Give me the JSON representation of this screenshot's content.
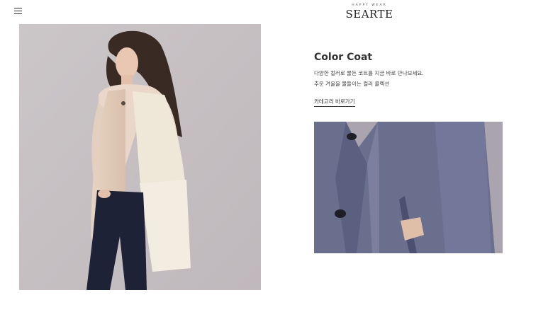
{
  "header": {
    "menu_icon": "hamburger-menu-icon",
    "logo_tagline": "HAPPY WEAR",
    "logo_text": "SEARTE"
  },
  "hero": {
    "image": "model-in-beige-shearling-vest-photo"
  },
  "product": {
    "title": "Color Coat",
    "desc_line_1": "다양한 컬러로 물든 코트를 지금 바로 만나보세요.",
    "desc_line_2": "추운 겨울을 물들이는 컬러 콜렉션",
    "link_label": "카테고리 바로가기"
  },
  "detail": {
    "image": "navy-wool-coat-closeup-photo"
  },
  "colors": {
    "hero_background": "#c5bfc2",
    "coat": "#6b6f8e",
    "detail_background": "#a7a3ad"
  }
}
